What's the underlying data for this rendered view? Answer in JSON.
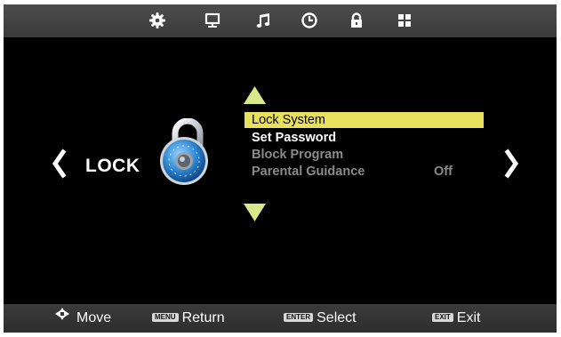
{
  "tabs": [
    {
      "name": "picture-tab",
      "icon": "gear-icon"
    },
    {
      "name": "display-tab",
      "icon": "monitor-icon"
    },
    {
      "name": "sound-tab",
      "icon": "music-note-icon"
    },
    {
      "name": "time-tab",
      "icon": "clock-icon"
    },
    {
      "name": "lock-tab",
      "icon": "padlock-icon",
      "active": true
    },
    {
      "name": "setup-tab",
      "icon": "grid-icon"
    }
  ],
  "menu": {
    "title": "LOCK",
    "items": [
      {
        "label": "Lock System",
        "value": "",
        "state": "selected"
      },
      {
        "label": "Set Password",
        "value": "",
        "state": "enabled"
      },
      {
        "label": "Block Program",
        "value": "",
        "state": "disabled"
      },
      {
        "label": "Parental Guidance",
        "value": "Off",
        "state": "disabled"
      }
    ]
  },
  "hints": {
    "move": {
      "label": "Move"
    },
    "return": {
      "key": "MENU",
      "label": "Return"
    },
    "select": {
      "key": "ENTER",
      "label": "Select"
    },
    "exit": {
      "key": "EXIT",
      "label": "Exit"
    }
  },
  "colors": {
    "highlight": "#e9e15d",
    "triangle": "#d9e88a",
    "disabled_text": "#8a8a8a"
  }
}
